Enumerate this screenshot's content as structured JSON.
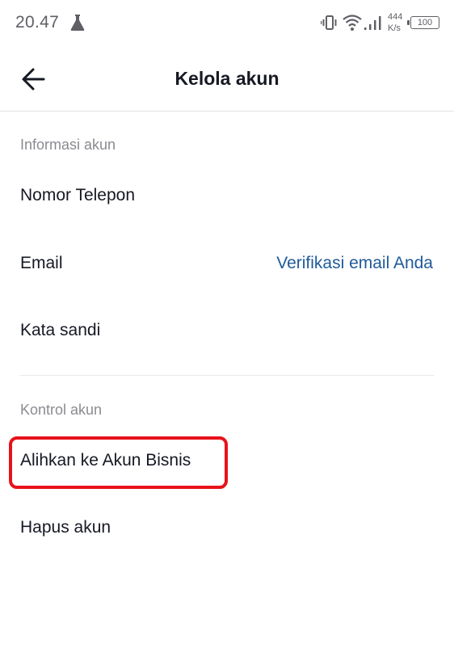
{
  "status_bar": {
    "time": "20.47",
    "net_speed_value": "444",
    "net_speed_unit": "K/s",
    "battery": "100",
    "icons": [
      "flask-icon",
      "vibrate-icon",
      "wifi-icon",
      "signal-icon",
      "battery-icon"
    ]
  },
  "header": {
    "title": "Kelola akun",
    "back_icon": "arrow-left-icon"
  },
  "account_info": {
    "section_title": "Informasi akun",
    "rows": [
      {
        "label": "Nomor Telepon",
        "value": ""
      },
      {
        "label": "Email",
        "value": "Verifikasi email Anda"
      },
      {
        "label": "Kata sandi",
        "value": ""
      }
    ]
  },
  "account_control": {
    "section_title": "Kontrol akun",
    "rows": [
      {
        "label": "Alihkan ke Akun Bisnis",
        "highlighted": true
      },
      {
        "label": "Hapus akun",
        "highlighted": false
      }
    ]
  },
  "colors": {
    "text_primary": "#161823",
    "text_secondary": "#8a8b91",
    "link": "#1f5a99",
    "highlight": "#e8121a"
  }
}
